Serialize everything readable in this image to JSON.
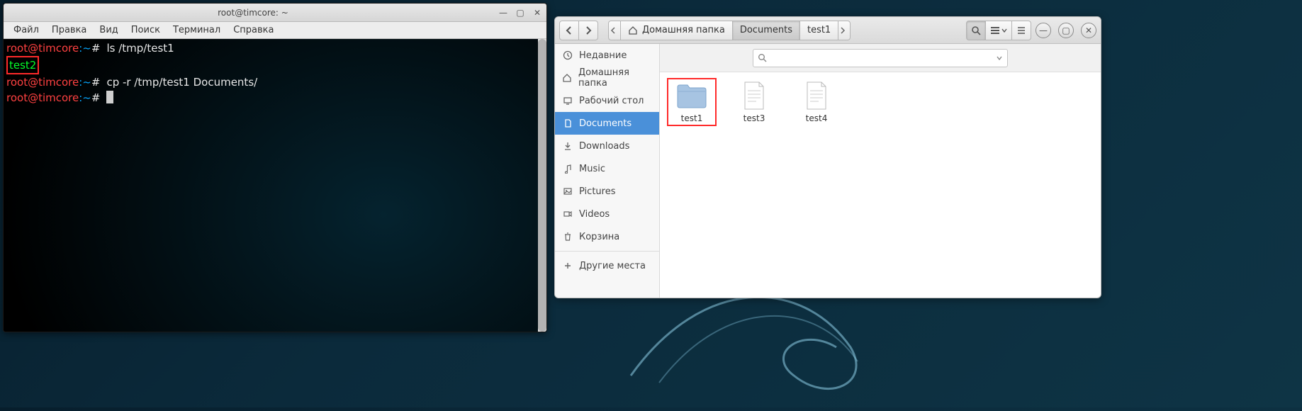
{
  "terminal": {
    "title": "root@timcore: ~",
    "menu": {
      "file": "Файл",
      "edit": "Правка",
      "view": "Вид",
      "search": "Поиск",
      "terminal": "Терминал",
      "help": "Справка"
    },
    "prompt_user": "root@timcore",
    "prompt_path": "~",
    "prompt_sep": ":",
    "prompt_sym": "#",
    "line1_cmd": "ls /tmp/test1",
    "line1_out": "test2",
    "line2_cmd": "cp -r /tmp/test1 Documents/"
  },
  "filemanager": {
    "pathbar": {
      "home": "Домашняя папка",
      "documents": "Documents",
      "test1": "test1"
    },
    "toolbar_icons": {
      "back": "back",
      "forward": "forward",
      "search": "search",
      "list": "list-view",
      "menu": "hamburger"
    },
    "search_placeholder": "",
    "sidebar": {
      "items": [
        {
          "label": "Недавние",
          "icon": "clock"
        },
        {
          "label": "Домашняя папка",
          "icon": "home"
        },
        {
          "label": "Рабочий стол",
          "icon": "desktop"
        },
        {
          "label": "Documents",
          "icon": "document",
          "active": true
        },
        {
          "label": "Downloads",
          "icon": "download"
        },
        {
          "label": "Music",
          "icon": "music"
        },
        {
          "label": "Pictures",
          "icon": "pictures"
        },
        {
          "label": "Videos",
          "icon": "videos"
        },
        {
          "label": "Корзина",
          "icon": "trash"
        }
      ],
      "other_places": "Другие места"
    },
    "items": [
      {
        "name": "test1",
        "type": "folder",
        "highlighted": true
      },
      {
        "name": "test3",
        "type": "file"
      },
      {
        "name": "test4",
        "type": "file"
      }
    ]
  }
}
